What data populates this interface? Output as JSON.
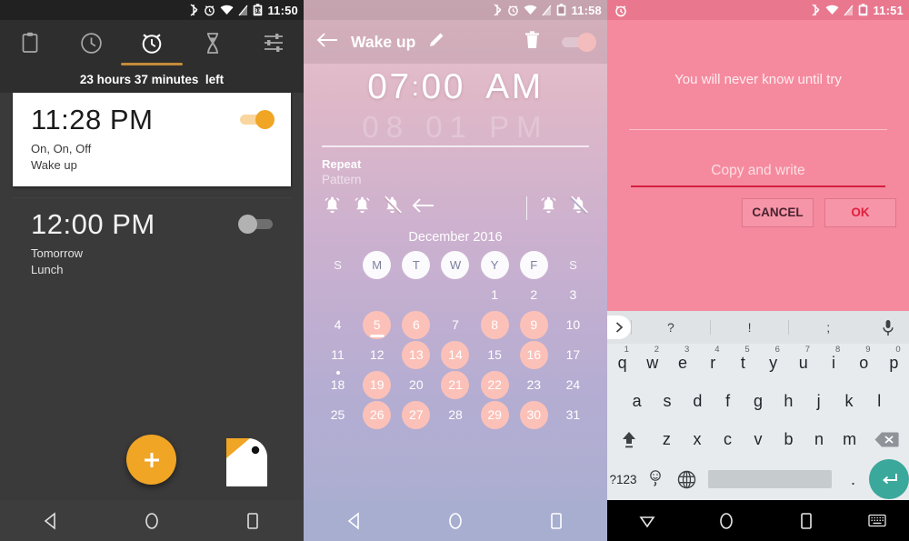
{
  "panel1": {
    "statusbar": {
      "time": "11:50",
      "icons": [
        "bluetooth-icon",
        "alarm-icon",
        "wifi-icon",
        "signal-off-icon",
        "battery-icon"
      ]
    },
    "tabs": [
      {
        "name": "tab-clipboard",
        "icon": "clipboard-icon",
        "active": false
      },
      {
        "name": "tab-clock",
        "icon": "clock-icon",
        "active": false
      },
      {
        "name": "tab-alarm",
        "icon": "alarm-clock-icon",
        "active": true
      },
      {
        "name": "tab-timer",
        "icon": "hourglass-icon",
        "active": false
      },
      {
        "name": "tab-stopwatch",
        "icon": "sliders-icon",
        "active": false
      }
    ],
    "countdown": "23 hours 37 minutes  left",
    "alarms": [
      {
        "time": "11:28 PM",
        "repeat": "On, On, Off",
        "label": "Wake up",
        "enabled": true,
        "toggle_color": "#f0a525"
      },
      {
        "time": "12:00 PM",
        "repeat": "Tomorrow",
        "label": "Lunch",
        "enabled": false,
        "toggle_color": "#b2b2b2"
      }
    ],
    "fab_label": "+",
    "fab_color": "#f0a525",
    "brand_icon": "bird-logo-icon",
    "nav": [
      "back-icon",
      "home-icon",
      "recents-icon"
    ]
  },
  "panel2": {
    "statusbar": {
      "time": "11:58",
      "icons": [
        "bluetooth-icon",
        "alarm-icon",
        "wifi-icon",
        "signal-off-icon",
        "battery-icon"
      ]
    },
    "appbar": {
      "back": "back-arrow-icon",
      "title": "Wake up",
      "edit": "pencil-icon",
      "delete": "trash-icon",
      "toggle_on": true,
      "toggle_color": "#f3bdbd"
    },
    "time": {
      "hour": "07",
      "colon": ":",
      "minute": "00",
      "meridiem": "AM",
      "ghost": "08  01  PM"
    },
    "repeat": {
      "label": "Repeat",
      "value": "Pattern"
    },
    "bells_left": [
      "bell-on-icon",
      "bell-on-icon",
      "bell-off-icon",
      "back-arrow-icon"
    ],
    "bells_right": [
      "bell-on-icon",
      "bell-off-icon"
    ],
    "month": "December 2016",
    "dow": [
      {
        "letter": "S",
        "selected": false
      },
      {
        "letter": "M",
        "selected": true
      },
      {
        "letter": "T",
        "selected": true
      },
      {
        "letter": "W",
        "selected": true
      },
      {
        "letter": "Y",
        "selected": true
      },
      {
        "letter": "F",
        "selected": true
      },
      {
        "letter": "S",
        "selected": false
      }
    ],
    "weeks": [
      [
        {
          "d": ""
        },
        {
          "d": ""
        },
        {
          "d": ""
        },
        {
          "d": ""
        },
        {
          "d": "1"
        },
        {
          "d": "2"
        },
        {
          "d": "3"
        }
      ],
      [
        {
          "d": "4"
        },
        {
          "d": "5",
          "hl": true,
          "today": true
        },
        {
          "d": "6",
          "hl": true
        },
        {
          "d": "7"
        },
        {
          "d": "8",
          "hl": true
        },
        {
          "d": "9",
          "hl": true
        },
        {
          "d": "10"
        }
      ],
      [
        {
          "d": "11"
        },
        {
          "d": "12"
        },
        {
          "d": "13",
          "hl": true
        },
        {
          "d": "14",
          "hl": true
        },
        {
          "d": "15"
        },
        {
          "d": "16",
          "hl": true
        },
        {
          "d": "17"
        }
      ],
      [
        {
          "d": "18",
          "dot": true
        },
        {
          "d": "19",
          "hl": true
        },
        {
          "d": "20"
        },
        {
          "d": "21",
          "hl": true
        },
        {
          "d": "22",
          "hl": true
        },
        {
          "d": "23"
        },
        {
          "d": "24"
        }
      ],
      [
        {
          "d": "25"
        },
        {
          "d": "26",
          "hl": true
        },
        {
          "d": "27",
          "hl": true
        },
        {
          "d": "28"
        },
        {
          "d": "29",
          "hl": true
        },
        {
          "d": "30",
          "hl": true
        },
        {
          "d": "31"
        }
      ]
    ],
    "highlight_color": "#fbc1b8",
    "nav": [
      "back-icon",
      "home-icon",
      "recents-icon"
    ]
  },
  "panel3": {
    "statusbar": {
      "alarm_icon": "alarm-clock-icon",
      "time": "11:51",
      "icons": [
        "bluetooth-icon",
        "wifi-icon",
        "signal-off-icon",
        "battery-icon"
      ]
    },
    "message": "You will never know until try",
    "input": {
      "placeholder": "Copy and write",
      "value": "",
      "underline_color": "#d41f3f"
    },
    "buttons": {
      "cancel": "CANCEL",
      "ok": "OK",
      "ok_color": "#e0203f"
    },
    "keyboard": {
      "suggestions": [
        "?",
        "!",
        ";"
      ],
      "expand_icon": "chevron-right-icon",
      "mic_icon": "microphone-icon",
      "row1": [
        {
          "k": "q",
          "n": "1"
        },
        {
          "k": "w",
          "n": "2"
        },
        {
          "k": "e",
          "n": "3"
        },
        {
          "k": "r",
          "n": "4"
        },
        {
          "k": "t",
          "n": "5"
        },
        {
          "k": "y",
          "n": "6"
        },
        {
          "k": "u",
          "n": "7"
        },
        {
          "k": "i",
          "n": "8"
        },
        {
          "k": "o",
          "n": "9"
        },
        {
          "k": "p",
          "n": "0"
        }
      ],
      "row2": [
        {
          "k": "a"
        },
        {
          "k": "s"
        },
        {
          "k": "d"
        },
        {
          "k": "f"
        },
        {
          "k": "g"
        },
        {
          "k": "h"
        },
        {
          "k": "j"
        },
        {
          "k": "k"
        },
        {
          "k": "l"
        }
      ],
      "row3": [
        {
          "k": "z"
        },
        {
          "k": "x"
        },
        {
          "k": "c"
        },
        {
          "k": "v"
        },
        {
          "k": "b"
        },
        {
          "k": "n"
        },
        {
          "k": "m"
        }
      ],
      "shift_icon": "shift-icon",
      "backspace_icon": "backspace-icon",
      "symbols_key": "?123",
      "comma_key": ",",
      "emoji_icon": "emoji-icon",
      "globe_icon": "language-globe-icon",
      "period_key": ".",
      "enter_icon": "enter-icon",
      "enter_color": "#3aa89b"
    },
    "nav": [
      "hide-keyboard-icon",
      "home-icon",
      "recents-icon",
      "keyboard-switch-icon"
    ]
  }
}
